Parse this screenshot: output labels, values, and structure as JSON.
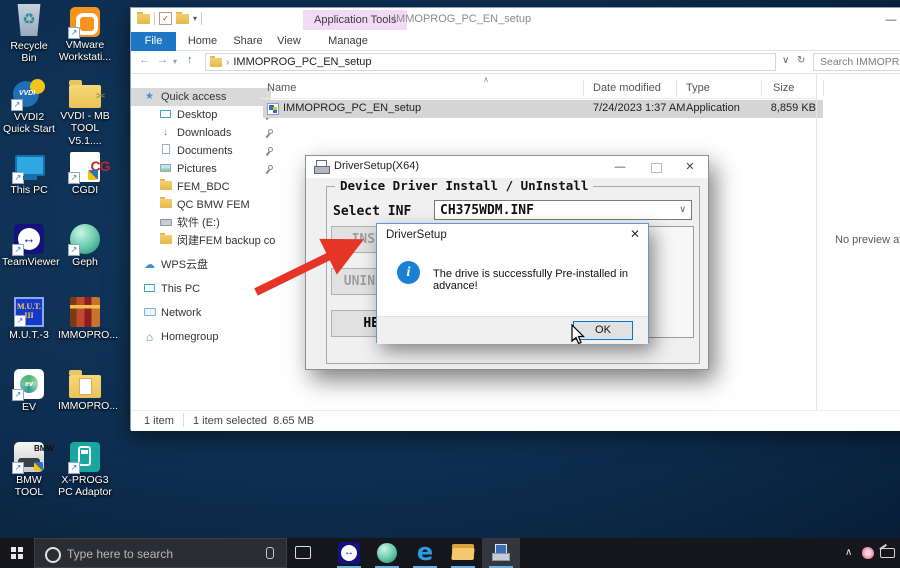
{
  "glyphs": {
    "recycle": "♻",
    "shortcut_arrow": "↗",
    "scissors": "✂",
    "tv_arrows": "↔",
    "minimize": "—",
    "close": "✕",
    "back": "←",
    "forward": "→",
    "up": "↑",
    "refresh": "↻",
    "dropdown": "∨",
    "dropdown_small": "▾",
    "sort_asc": "∧",
    "chevron": "›",
    "check": "✓",
    "star": "★",
    "down_arrow": "↓",
    "cloud": "☁",
    "house": "⌂",
    "tray_chevron": "∧",
    "edge_logo": "e",
    "info": "i"
  },
  "desktop": {
    "icons": [
      {
        "label": "Recycle Bin"
      },
      {
        "label": "VMware Workstati..."
      },
      {
        "label": "VVDI2 Quick Start",
        "icon_text": "VVDI"
      },
      {
        "label": "VVDI - MB TOOL V5.1...."
      },
      {
        "label": "This PC"
      },
      {
        "label": "CGDI",
        "icon_text": "CG"
      },
      {
        "label": "TeamViewer"
      },
      {
        "label": "Geph"
      },
      {
        "label": "M.U.T.-3",
        "icon_line1": "M.U.T.",
        "icon_line2": "III"
      },
      {
        "label": "IMMOPRO..."
      },
      {
        "label": "EV",
        "icon_text": "ev"
      },
      {
        "label": "IMMOPRO..."
      },
      {
        "label": "BMW TOOL",
        "icon_text": "BMW"
      },
      {
        "label": "X-PROG3 PC Adaptor"
      }
    ]
  },
  "explorer": {
    "window_title": "IMMOPROG_PC_EN_setup",
    "contextual_tab": "Application Tools",
    "tabs": [
      "File",
      "Home",
      "Share",
      "View",
      "Manage"
    ],
    "address": "IMMOPROG_PC_EN_setup",
    "search_placeholder": "Search IMMOPROG",
    "sidebar": [
      "Quick access",
      "Desktop",
      "Downloads",
      "Documents",
      "Pictures",
      "FEM_BDC",
      "QC BMW FEM",
      "软件 (E:)",
      "闵建FEM backup co",
      "WPS云盘",
      "This PC",
      "Network",
      "Homegroup"
    ],
    "columns": [
      "Name",
      "Date modified",
      "Type",
      "Size"
    ],
    "file": {
      "name": "IMMOPROG_PC_EN_setup",
      "date_modified": "7/24/2023 1:37 AM",
      "type": "Application",
      "size": "8,859 KB"
    },
    "preview_text": "No preview available",
    "status_items": "1 item",
    "status_selected": "1 item selected",
    "status_size": "8.65 MB"
  },
  "driver_dialog": {
    "title": "DriverSetup(X64)",
    "section_title": "Device Driver Install / UnInstall",
    "select_inf_label": "Select INF",
    "inf_value": "CH375WDM.INF",
    "install_label": "INSTALL",
    "uninstall_label": "UNINSTALL",
    "help_label": "HELP"
  },
  "message_box": {
    "title": "DriverSetup",
    "message": "The drive is successfully Pre-installed in advance!",
    "ok_label": "OK"
  },
  "taskbar": {
    "search_placeholder": "Type here to search"
  }
}
